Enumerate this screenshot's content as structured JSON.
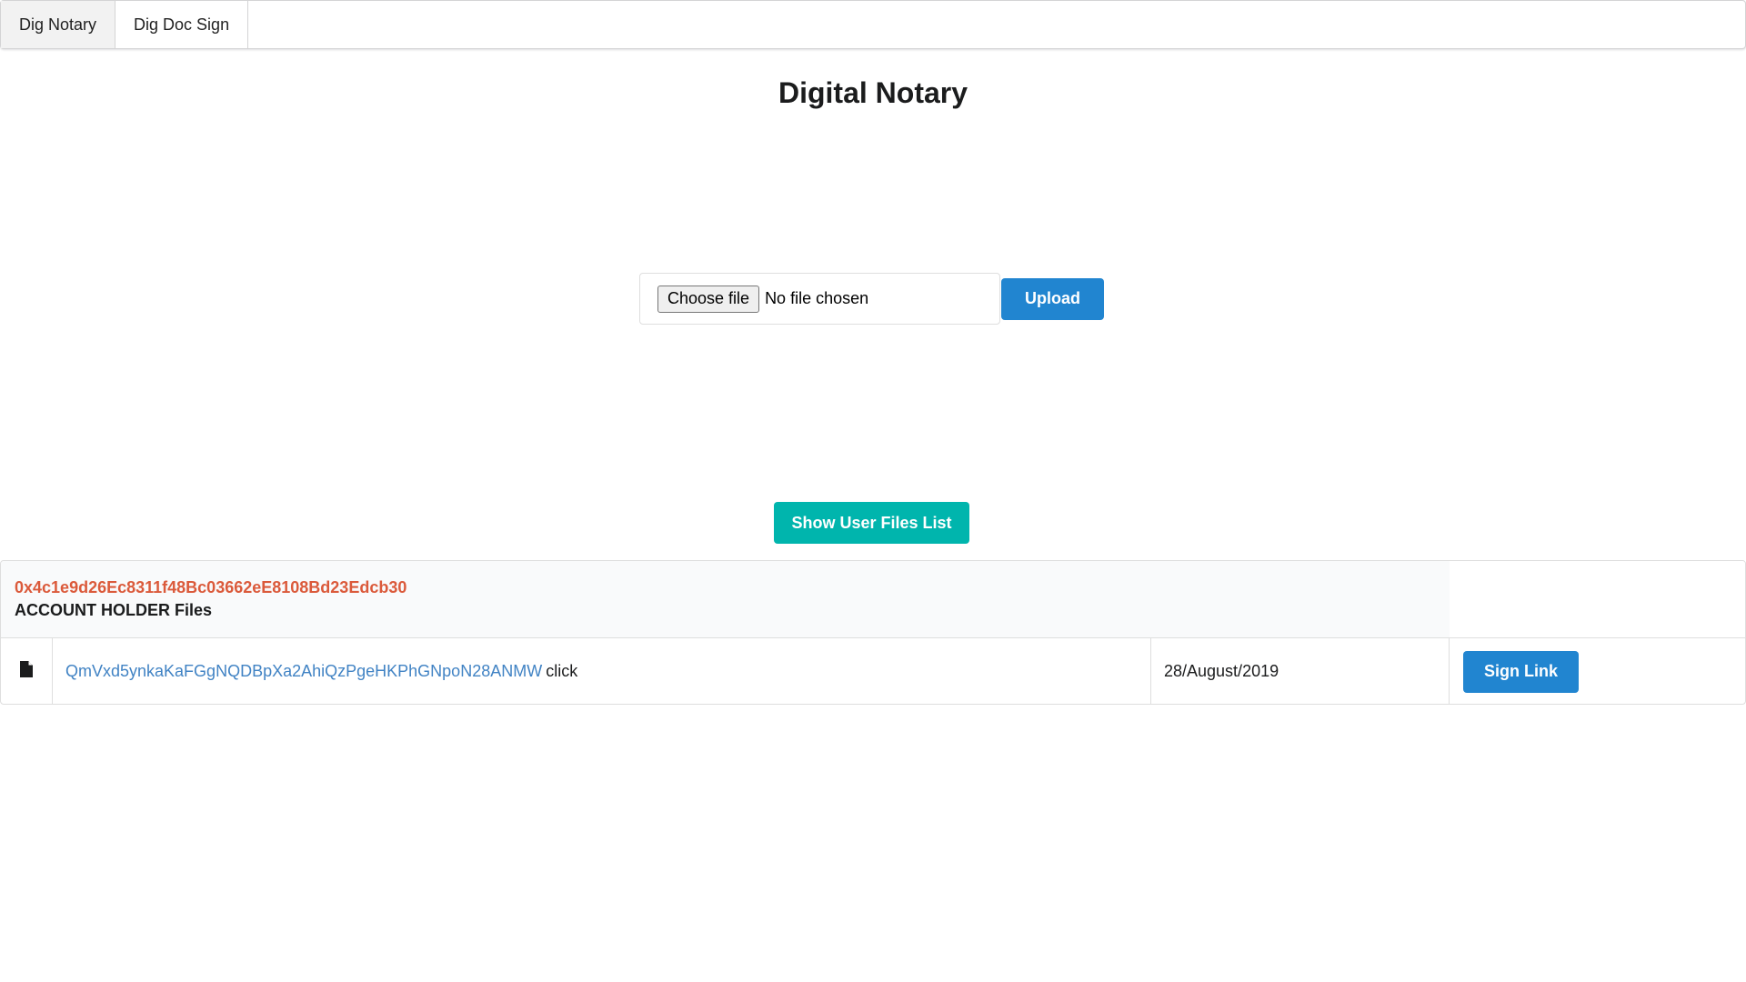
{
  "menu": {
    "items": [
      {
        "label": "Dig Notary"
      },
      {
        "label": "Dig Doc Sign"
      }
    ]
  },
  "page": {
    "title": "Digital Notary"
  },
  "upload": {
    "choose_label": "Choose file",
    "file_status": "No file chosen",
    "button_label": "Upload"
  },
  "show_list_label": "Show User Files List",
  "files": {
    "account_address": "0x4c1e9d26Ec8311f48Bc03662eE8108Bd23Edcb30",
    "account_label": "ACCOUNT HOLDER Files",
    "rows": [
      {
        "icon": "file-icon",
        "hash": "QmVxd5ynkaKaFGgNQDBpXa2AhiQzPgeHKPhGNpoN28ANMW",
        "link_suffix": "click",
        "date": "28/August/2019",
        "action_label": "Sign Link"
      }
    ]
  },
  "colors": {
    "primary": "#2185d0",
    "teal": "#00b5ad",
    "address": "#db5a3b",
    "link": "#4183c4"
  }
}
